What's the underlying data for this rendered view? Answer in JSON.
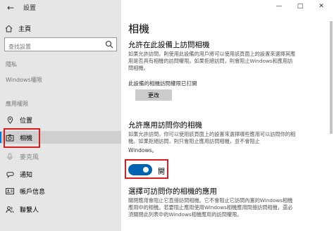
{
  "window": {
    "title": "設置",
    "back_icon": "back-arrow-icon",
    "minimize": "—",
    "maximize": "□",
    "close": "✕"
  },
  "sidebar": {
    "home_label": "主頁",
    "search_placeholder": "查找設置",
    "privacy_label": "隱私",
    "windows_perm_label": "Windows權限",
    "app_perm_label": "應用權限",
    "items": [
      {
        "label": "位置",
        "icon": "location-icon"
      },
      {
        "label": "相機",
        "icon": "camera-icon"
      },
      {
        "label": "麥克風",
        "icon": "microphone-icon"
      },
      {
        "label": "通知",
        "icon": "notification-icon"
      },
      {
        "label": "帳戶信息",
        "icon": "account-info-icon"
      },
      {
        "label": "聯繫人",
        "icon": "contacts-icon"
      }
    ]
  },
  "main": {
    "title": "相機",
    "section1_heading": "允許在此設備上訪問相機",
    "section1_body": "如果允許訪問，則使用此設備的用戶將可以使用該頁面上的設置來選擇其應用是否具有相機的訪問權限。如果拒絕訪問，則會阻止Windows和應用訪問相機。",
    "device_status": "此設備的相機訪問權限已打開",
    "change_button": "更改",
    "section2_heading": "允許應用訪問你的相機",
    "section2_body": "如果允許訪問，你可以使用該頁面上的設置來選擇哪些應用可以訪問你的相機。如果拒絕訪問，則只會阻止應用訪問相機，並不會阻止",
    "section2_body_tail": "Windows。",
    "toggle_label": "開",
    "toggle_on": true,
    "section3_heading": "選擇可訪問你的相機的應用",
    "section3_body": "關閉應用會阻止它直接訪問相機。它不會阻止它訪問內置的Windows相機應用中的相機。若要阻止應用使用Windows相機應用間接訪問相機，還必須關閉此列表中的Windows相機應用的訪問權限。"
  },
  "colors": {
    "accent": "#0063b1",
    "highlight": "#d81e1e",
    "sidebar_bg": "#e6e6e6"
  }
}
